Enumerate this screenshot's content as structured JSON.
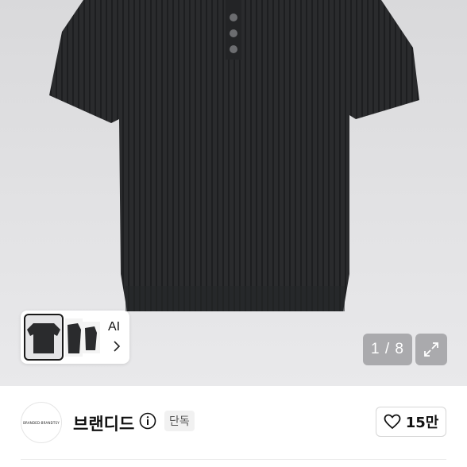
{
  "gallery": {
    "page_indicator": "1 / 8",
    "ai_label": "AI",
    "expand_icon": "expand-arrows-icon"
  },
  "seller": {
    "name": "브랜디드",
    "badge": "단독",
    "avatar_text": "BRANDED-BRANDTSY"
  },
  "like": {
    "count": "15만",
    "icon": "heart-outline-icon"
  },
  "colors": {
    "shirt": "#2a2b2d",
    "hero_bg": "#e0e0e2"
  }
}
